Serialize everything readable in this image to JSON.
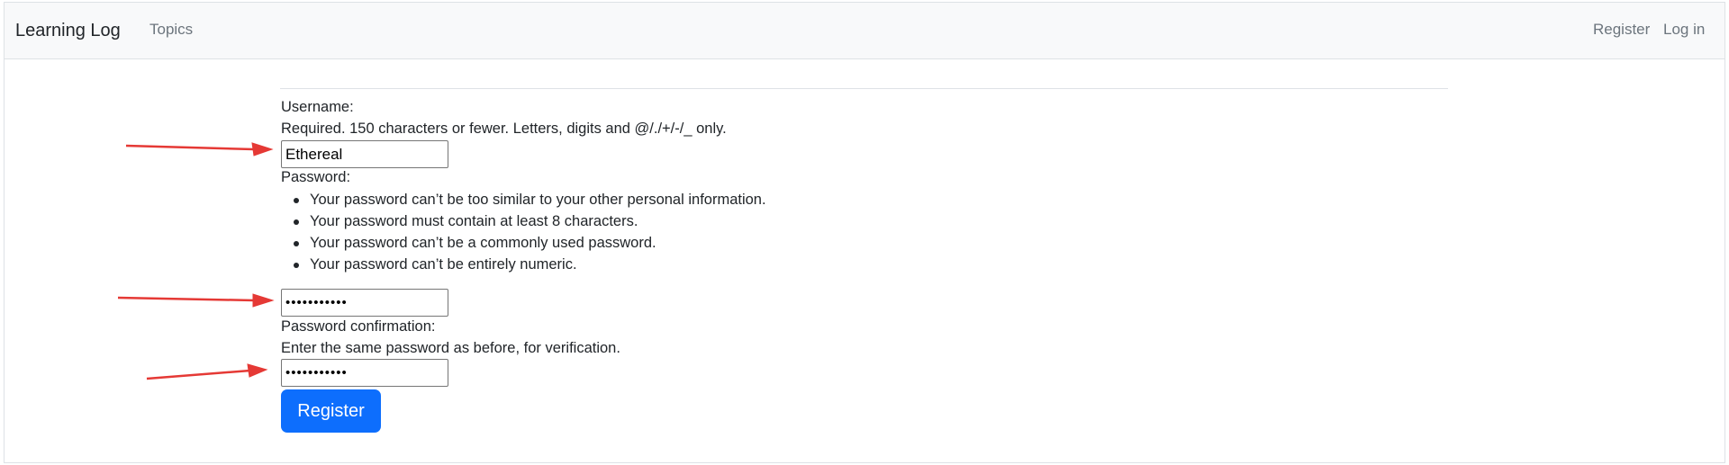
{
  "navbar": {
    "brand": "Learning Log",
    "topics": "Topics",
    "register": "Register",
    "login": "Log in"
  },
  "form": {
    "username_label": "Username:",
    "username_help": "Required. 150 characters or fewer. Letters, digits and @/./+/-/_ only.",
    "username_value": "Ethereal",
    "password_label": "Password:",
    "password_help": [
      "Your password can’t be too similar to your other personal information.",
      "Your password must contain at least 8 characters.",
      "Your password can’t be a commonly used password.",
      "Your password can’t be entirely numeric."
    ],
    "password_value": "•••••••••••",
    "confirm_label": "Password confirmation:",
    "confirm_help": "Enter the same password as before, for verification.",
    "confirm_value": "•••••••••••",
    "submit_label": "Register"
  },
  "colors": {
    "accent": "#0d6efd",
    "annotation_arrow": "#e53935",
    "navbar_bg": "#f8f9fa"
  }
}
